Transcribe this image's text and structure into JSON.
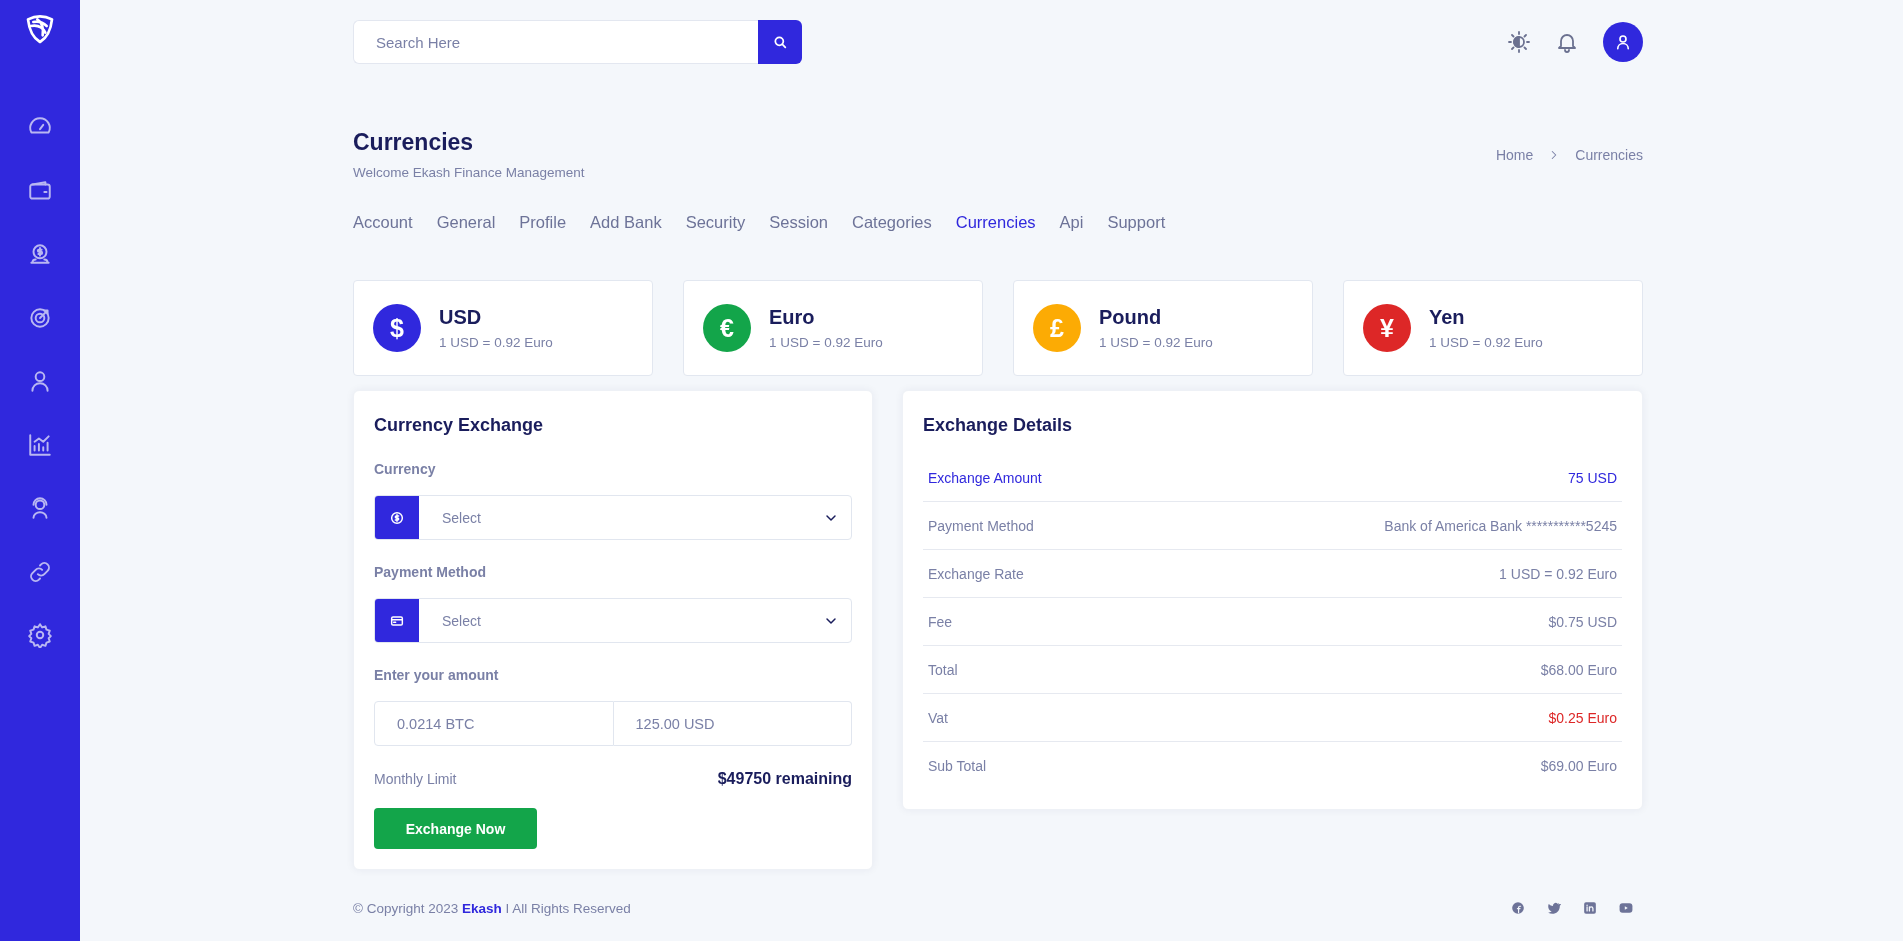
{
  "search": {
    "placeholder": "Search Here"
  },
  "page": {
    "title": "Currencies",
    "subtitle": "Welcome Ekash Finance Management"
  },
  "breadcrumb": [
    "Home",
    "Currencies"
  ],
  "tabs": [
    {
      "label": "Account",
      "selected": false
    },
    {
      "label": "General",
      "selected": false
    },
    {
      "label": "Profile",
      "selected": false
    },
    {
      "label": "Add Bank",
      "selected": false
    },
    {
      "label": "Security",
      "selected": false
    },
    {
      "label": "Session",
      "selected": false
    },
    {
      "label": "Categories",
      "selected": false
    },
    {
      "label": "Currencies",
      "selected": true
    },
    {
      "label": "Api",
      "selected": false
    },
    {
      "label": "Support",
      "selected": false
    }
  ],
  "currencies": [
    {
      "symbol": "$",
      "name": "USD",
      "rate": "1 USD = 0.92 Euro",
      "color": "#3028dd"
    },
    {
      "symbol": "€",
      "name": "Euro",
      "rate": "1 USD = 0.92 Euro",
      "color": "#13a54a"
    },
    {
      "symbol": "£",
      "name": "Pound",
      "rate": "1 USD = 0.92 Euro",
      "color": "#fcab04"
    },
    {
      "symbol": "¥",
      "name": "Yen",
      "rate": "1 USD = 0.92 Euro",
      "color": "#dd2727"
    }
  ],
  "exchange_form": {
    "title": "Currency Exchange",
    "selects": [
      {
        "kind": "coin",
        "label": "Currency",
        "placeholder": "Select"
      },
      {
        "kind": "card",
        "label": "Payment Method",
        "placeholder": "Select"
      }
    ],
    "amount_label": "Enter your amount",
    "amounts": [
      "0.0214 BTC",
      "125.00 USD"
    ],
    "limit_label": "Monthly Limit",
    "limit_value": "$49750 remaining",
    "button": "Exchange Now"
  },
  "exchange_details": {
    "title": "Exchange Details",
    "rows": [
      {
        "kind": "primary",
        "label": "Exchange Amount",
        "value": "75 USD"
      },
      {
        "kind": "plain",
        "label": "Payment Method",
        "value": "Bank of America Bank ***********5245"
      },
      {
        "kind": "plain",
        "label": "Exchange Rate",
        "value": "1 USD = 0.92 Euro"
      },
      {
        "kind": "plain",
        "label": "Fee",
        "value": "$0.75 USD"
      },
      {
        "kind": "plain",
        "label": "Total",
        "value": "$68.00 Euro"
      },
      {
        "kind": "danger",
        "label": "Vat",
        "value": "$0.25 Euro"
      },
      {
        "kind": "plain",
        "label": "Sub Total",
        "value": "$69.00 Euro"
      }
    ]
  },
  "footer": {
    "prefix": "© Copyright 2023 ",
    "brand": "Ekash",
    "suffix": " I All Rights Reserved"
  }
}
